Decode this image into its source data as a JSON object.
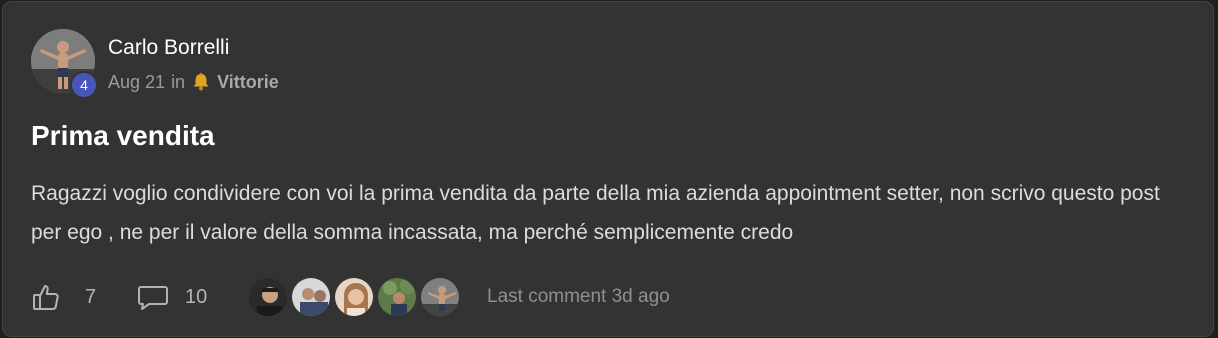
{
  "post": {
    "author": "Carlo Borrelli",
    "level": "4",
    "date": "Aug 21",
    "in_label": "in",
    "category_icon": "bell-icon",
    "category": "Vittorie",
    "title": "Prima vendita",
    "body": "Ragazzi voglio condividere con voi la prima vendita da parte della mia azienda appointment setter, non scrivo questo post per ego , ne per il valore della somma incassata, ma perché semplicemente credo"
  },
  "footer": {
    "likes": "7",
    "comments": "10",
    "last_comment": "Last comment 3d ago",
    "commenter_avatars": [
      "avatar-1",
      "avatar-2",
      "avatar-3",
      "avatar-4",
      "avatar-5"
    ]
  },
  "colors": {
    "card_background": "#333333",
    "level_badge": "#4756b8",
    "text_primary": "#ffffff",
    "text_muted": "#9a9a9a"
  }
}
